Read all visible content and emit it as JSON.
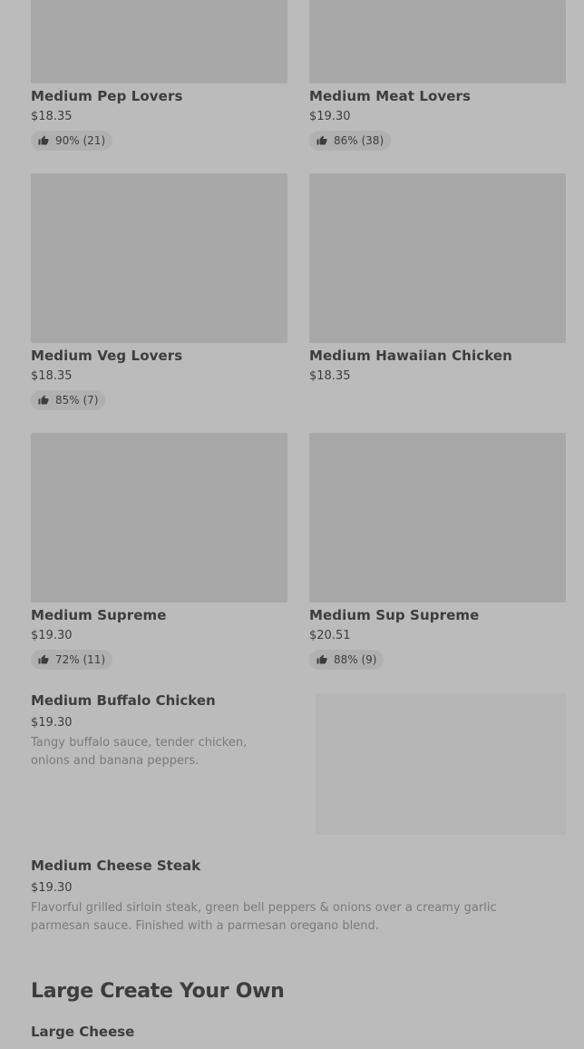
{
  "thumb_icon": "thumbs-up-icon",
  "colors": {
    "background": "#bbbbbb",
    "image_placeholder": "#a8a8a8",
    "text": "#3d3d3d",
    "muted_text": "#7a7a7a",
    "rating_pill": "#b0b0b0"
  },
  "grid": [
    {
      "name": "Medium Pep Lovers",
      "price": "$18.35",
      "rating": "90% (21)"
    },
    {
      "name": "Medium Meat Lovers",
      "price": "$19.30",
      "rating": "86% (38)"
    },
    {
      "name": "Medium Veg Lovers",
      "price": "$18.35",
      "rating": "85% (7)"
    },
    {
      "name": "Medium Hawaiian Chicken",
      "price": "$18.35",
      "rating": ""
    },
    {
      "name": "Medium Supreme",
      "price": "$19.30",
      "rating": "72% (11)"
    },
    {
      "name": "Medium Sup Supreme",
      "price": "$20.51",
      "rating": "88% (9)"
    }
  ],
  "list": [
    {
      "name": "Medium Buffalo Chicken",
      "price": "$19.30",
      "description": "Tangy buffalo sauce, tender chicken, onions and banana peppers."
    },
    {
      "name": "Medium Cheese Steak",
      "price": "$19.30",
      "description": "Flavorful grilled sirloin steak, green bell peppers & onions over a creamy garlic parmesan sauce. Finished with a parmesan oregano blend."
    }
  ],
  "next_section": {
    "title": "Large Create Your Own",
    "first_item": "Large Cheese"
  }
}
